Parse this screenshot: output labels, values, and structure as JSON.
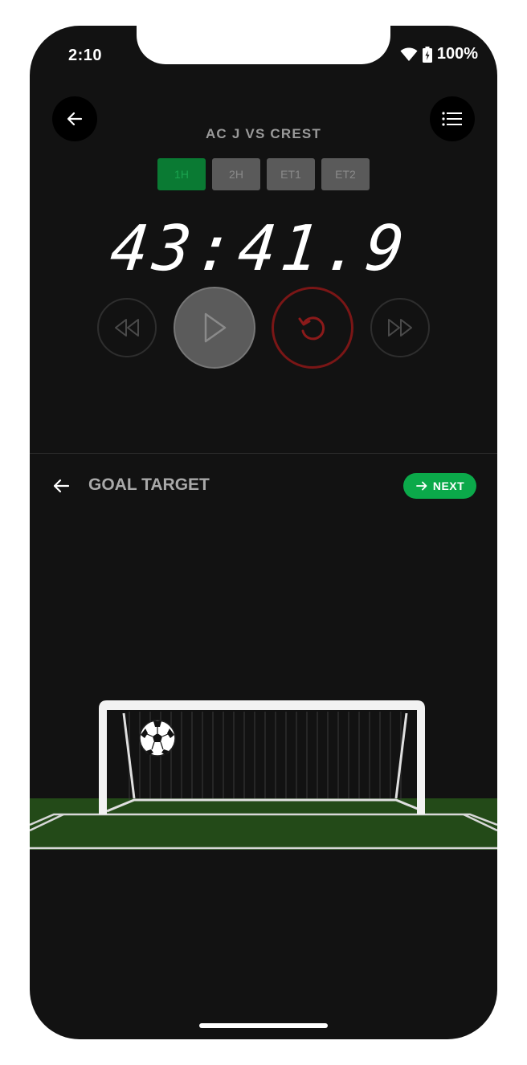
{
  "status": {
    "time": "2:10",
    "battery": "100%"
  },
  "match": {
    "title": "AC J VS CREST"
  },
  "periods": [
    "1H",
    "2H",
    "ET1",
    "ET2"
  ],
  "active_period": "1H",
  "clock": {
    "display": "43:41.9"
  },
  "controls": {
    "rewind": "rewind-icon",
    "play": "play-icon",
    "reset": "reset-icon",
    "forward": "fast-forward-icon"
  },
  "section": {
    "title": "GOAL TARGET",
    "next_label": "NEXT"
  },
  "colors": {
    "background": "#121212",
    "accent_green": "#0ba94a",
    "active_tab": "#0a7a33",
    "reset_red": "#8b1a1a",
    "pitch": "#234a18"
  }
}
